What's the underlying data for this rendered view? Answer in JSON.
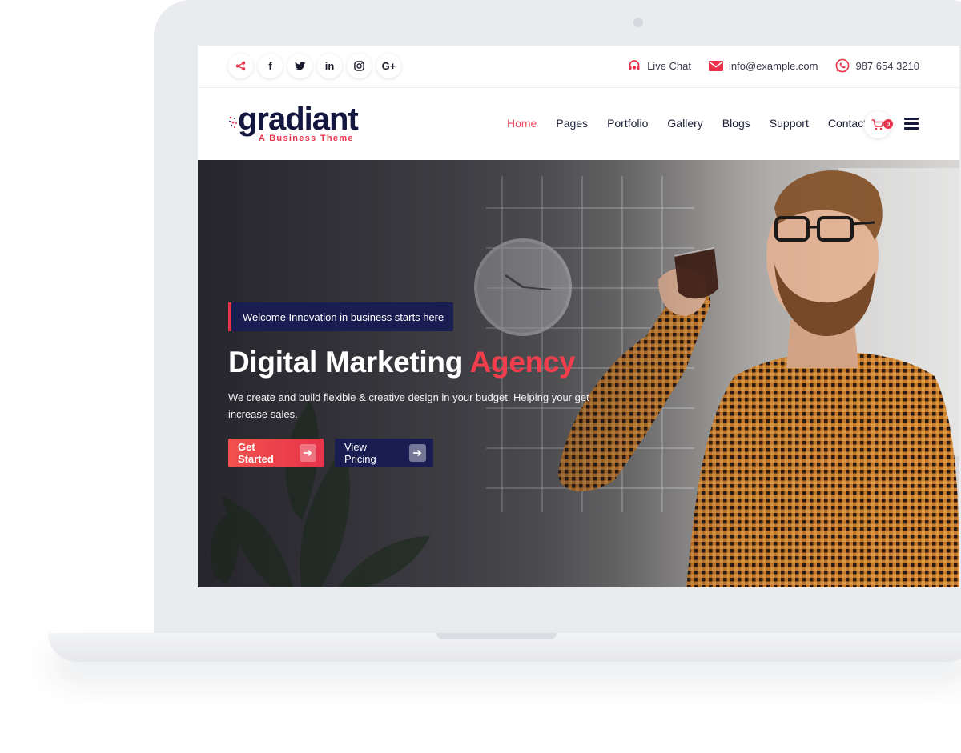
{
  "topbar": {
    "socials": [
      {
        "icon": "share-icon",
        "glyph": "<"
      },
      {
        "icon": "facebook-icon",
        "glyph": "f"
      },
      {
        "icon": "twitter-icon",
        "glyph": "t"
      },
      {
        "icon": "linkedin-icon",
        "glyph": "in"
      },
      {
        "icon": "instagram-icon",
        "glyph": "◎"
      },
      {
        "icon": "google-plus-icon",
        "glyph": "G+"
      }
    ],
    "live_chat": "Live Chat",
    "email": "info@example.com",
    "phone": "987 654 3210"
  },
  "brand": {
    "name": "gradiant",
    "tagline": "A Business Theme"
  },
  "nav": {
    "items": [
      "Home",
      "Pages",
      "Portfolio",
      "Gallery",
      "Blogs",
      "Support",
      "Contact"
    ],
    "active": "Home",
    "cart_count": "0"
  },
  "hero": {
    "eyebrow": "Welcome Innovation in business starts here",
    "title_main": "Digital Marketing",
    "title_accent": "Agency",
    "description": "We create and build flexible & creative design in your budget. Helping your get increase sales.",
    "primary_button": "Get Started",
    "secondary_button": "View Pricing"
  },
  "colors": {
    "accent": "#e8334a",
    "navy": "#1a1d52",
    "text_dark": "#131740"
  }
}
